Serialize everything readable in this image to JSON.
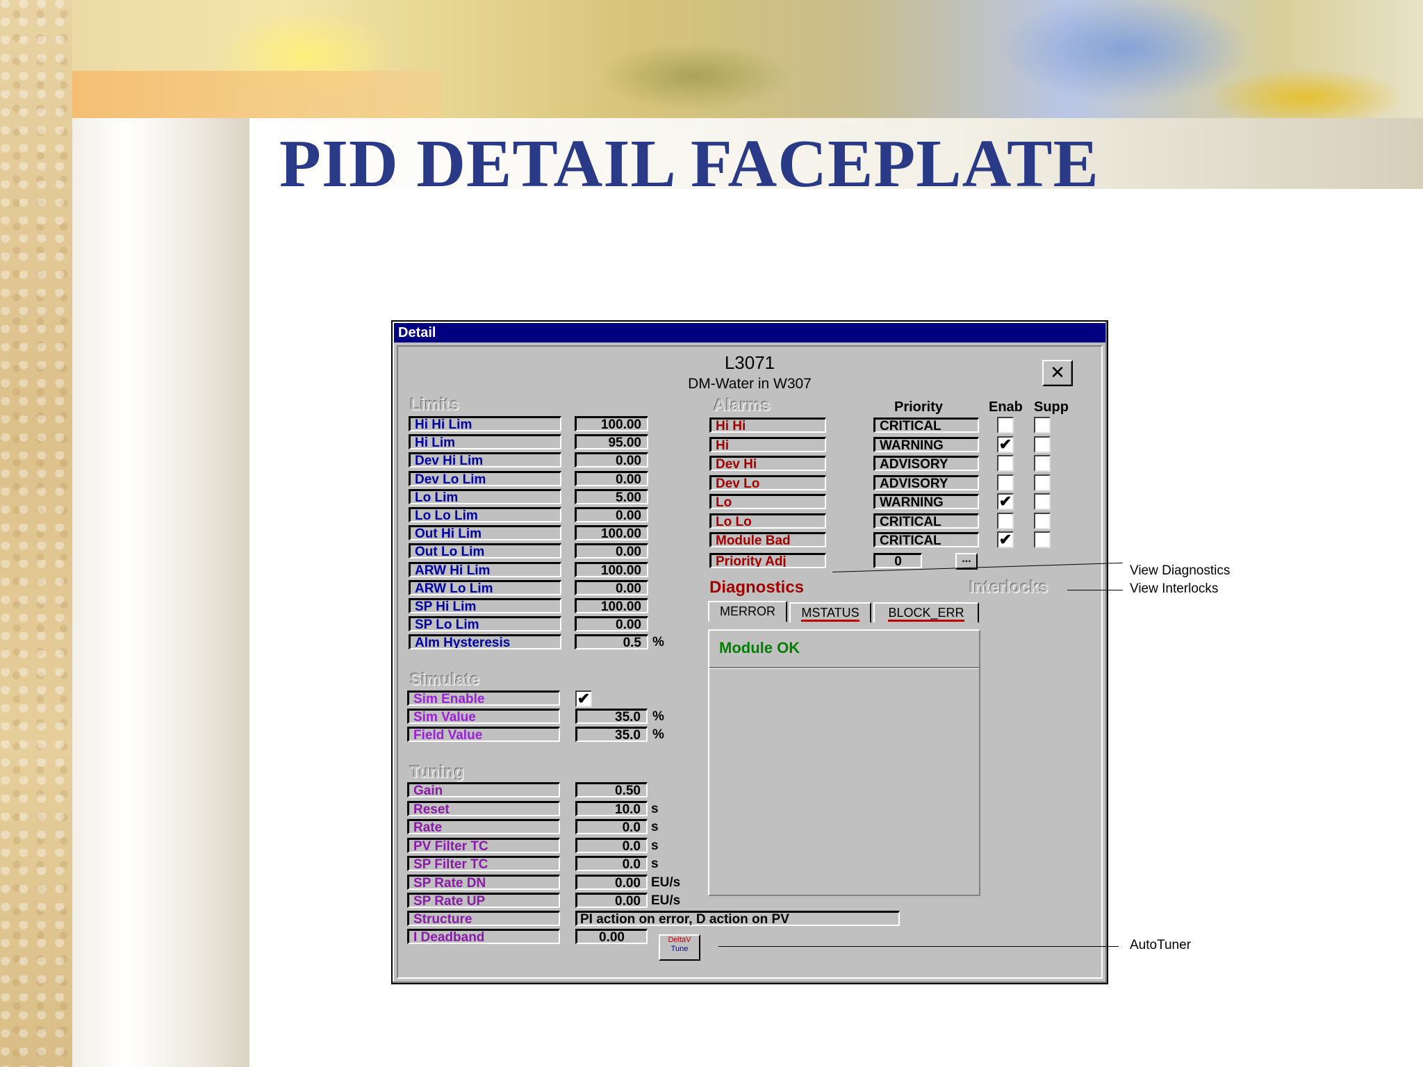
{
  "slide": {
    "title": "PID DETAIL FACEPLATE"
  },
  "window": {
    "title": "Detail",
    "tag": "L3071",
    "description": "DM-Water in W307",
    "close_label": "✕"
  },
  "limits": {
    "header": "Limits",
    "rows": [
      {
        "label": "Hi Hi Lim",
        "value": "100.00"
      },
      {
        "label": "Hi Lim",
        "value": "95.00"
      },
      {
        "label": "Dev Hi Lim",
        "value": "0.00"
      },
      {
        "label": "Dev Lo Lim",
        "value": "0.00"
      },
      {
        "label": "Lo Lim",
        "value": "5.00"
      },
      {
        "label": "Lo Lo Lim",
        "value": "0.00"
      },
      {
        "label": "Out Hi Lim",
        "value": "100.00"
      },
      {
        "label": "Out Lo Lim",
        "value": "0.00"
      },
      {
        "label": "ARW Hi Lim",
        "value": "100.00"
      },
      {
        "label": "ARW Lo Lim",
        "value": "0.00"
      },
      {
        "label": "SP Hi Lim",
        "value": "100.00"
      },
      {
        "label": "SP Lo Lim",
        "value": "0.00"
      },
      {
        "label": "Alm Hysteresis",
        "value": "0.5",
        "unit": "%"
      }
    ]
  },
  "simulate": {
    "header": "Simulate",
    "enable_label": "Sim Enable",
    "enable_checked": true,
    "check_mark": "✔",
    "rows": [
      {
        "label": "Sim Value",
        "value": "35.0",
        "unit": "%"
      },
      {
        "label": "Field Value",
        "value": "35.0",
        "unit": "%"
      }
    ]
  },
  "tuning": {
    "header": "Tuning",
    "rows": [
      {
        "label": "Gain",
        "value": "0.50",
        "unit": ""
      },
      {
        "label": "Reset",
        "value": "10.0",
        "unit": "s"
      },
      {
        "label": "Rate",
        "value": "0.0",
        "unit": "s"
      },
      {
        "label": "PV Filter TC",
        "value": "0.0",
        "unit": "s"
      },
      {
        "label": "SP Filter TC",
        "value": "0.0",
        "unit": "s"
      },
      {
        "label": "SP Rate DN",
        "value": "0.00",
        "unit": "EU/s"
      },
      {
        "label": "SP Rate UP",
        "value": "0.00",
        "unit": "EU/s"
      }
    ],
    "structure_label": "Structure",
    "structure_value": "PI action on error, D action on PV",
    "deadband_label": "I Deadband",
    "deadband_value": "0.00",
    "tune_button_line1": "DeltaV",
    "tune_button_line2": "Tune"
  },
  "alarms": {
    "header": "Alarms",
    "col_priority": "Priority",
    "col_enab": "Enab",
    "col_supp": "Supp",
    "rows": [
      {
        "label": "Hi Hi",
        "priority": "CRITICAL",
        "enab": "",
        "supp": ""
      },
      {
        "label": "Hi",
        "priority": "WARNING",
        "enab": "✔",
        "supp": ""
      },
      {
        "label": "Dev Hi",
        "priority": "ADVISORY",
        "enab": "",
        "supp": ""
      },
      {
        "label": "Dev Lo",
        "priority": "ADVISORY",
        "enab": "",
        "supp": ""
      },
      {
        "label": "Lo",
        "priority": "WARNING",
        "enab": "✔",
        "supp": ""
      },
      {
        "label": "Lo Lo",
        "priority": "CRITICAL",
        "enab": "",
        "supp": ""
      },
      {
        "label": "Module Bad",
        "priority": "CRITICAL",
        "enab": "✔",
        "supp": ""
      }
    ],
    "priority_adj_label": "Priority Adj",
    "priority_adj_value": "0",
    "more_button": "..."
  },
  "diagnostics": {
    "header": "Diagnostics",
    "interlocks": "Interlocks",
    "tabs": [
      "MERROR",
      "MSTATUS",
      "BLOCK_ERR"
    ],
    "message": "Module OK"
  },
  "callouts": {
    "view_diagnostics": "View Diagnostics",
    "view_interlocks": "View Interlocks",
    "autotuner": "AutoTuner"
  }
}
